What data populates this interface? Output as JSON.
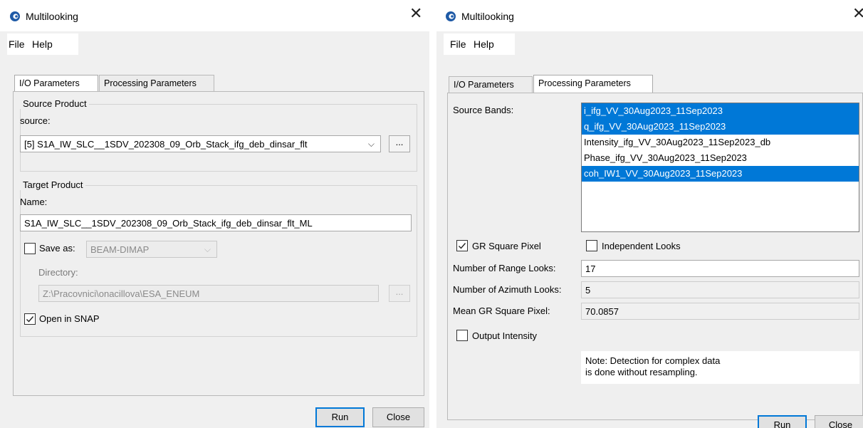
{
  "left": {
    "title": "Multilooking",
    "menu": [
      "File",
      "Help"
    ],
    "tabs": [
      "I/O Parameters",
      "Processing Parameters"
    ],
    "source_group": {
      "title": "Source Product",
      "source_label": "source:",
      "source_value": "[5] S1A_IW_SLC__1SDV_202308_09_Orb_Stack_ifg_deb_dinsar_flt",
      "browse_label": "..."
    },
    "target_group": {
      "title": "Target Product",
      "name_label": "Name:",
      "name_value": "S1A_IW_SLC__1SDV_202308_09_Orb_Stack_ifg_deb_dinsar_flt_ML",
      "save_as_label": "Save as:",
      "save_as_checked": false,
      "format_value": "BEAM-DIMAP",
      "directory_label": "Directory:",
      "directory_value": "Z:\\Pracovnici\\onacillova\\ESA_ENEUM",
      "browse_label": "...",
      "open_in_snap_label": "Open in SNAP",
      "open_in_snap_checked": true
    },
    "run_label": "Run",
    "close_label": "Close"
  },
  "right": {
    "title": "Multilooking",
    "menu": [
      "File",
      "Help"
    ],
    "tabs": [
      "I/O Parameters",
      "Processing Parameters"
    ],
    "source_bands_label": "Source Bands:",
    "bands": [
      {
        "name": "i_ifg_VV_30Aug2023_11Sep2023",
        "selected": true
      },
      {
        "name": "q_ifg_VV_30Aug2023_11Sep2023",
        "selected": true
      },
      {
        "name": "Intensity_ifg_VV_30Aug2023_11Sep2023_db",
        "selected": false
      },
      {
        "name": "Phase_ifg_VV_30Aug2023_11Sep2023",
        "selected": false
      },
      {
        "name": "coh_IW1_VV_30Aug2023_11Sep2023",
        "selected": true
      }
    ],
    "gr_square_pixel_label": "GR Square Pixel",
    "gr_square_pixel_checked": true,
    "independent_looks_label": "Independent Looks",
    "independent_looks_checked": false,
    "range_looks_label": "Number of Range Looks:",
    "range_looks_value": "17",
    "azimuth_looks_label": "Number of Azimuth Looks:",
    "azimuth_looks_value": "5",
    "mean_gr_label": "Mean GR Square Pixel:",
    "mean_gr_value": "70.0857",
    "output_intensity_label": "Output Intensity",
    "output_intensity_checked": false,
    "note_line1": "Note: Detection for complex data",
    "note_line2": "is done without resampling.",
    "run_label": "Run",
    "close_label": "Close"
  },
  "colors": {
    "selection": "#0078d7",
    "dialog_bg": "#f0f0f0",
    "logo_blue": "#1f5aa6"
  },
  "icons": {
    "app_icon": "esa-snap-logo-icon",
    "close": "close-icon",
    "combo": "chevron-down-icon",
    "check": "checkmark-icon"
  }
}
